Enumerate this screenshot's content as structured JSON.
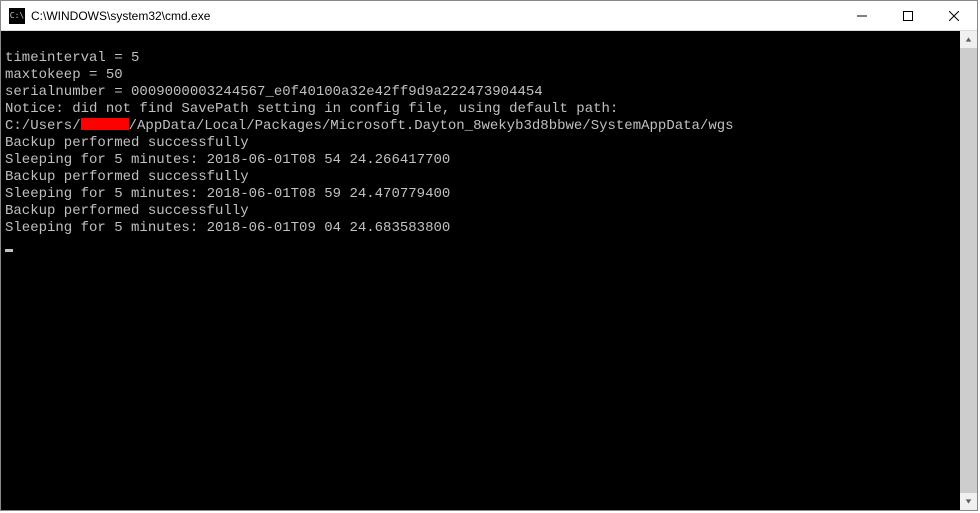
{
  "titlebar": {
    "title": "C:\\WINDOWS\\system32\\cmd.exe"
  },
  "terminal": {
    "lines": [
      "",
      "timeinterval = 5",
      "maxtokeep = 50",
      "serialnumber = 0009000003244567_e0f40100a32e42ff9d9a222473904454",
      "Notice: did not find SavePath setting in config file, using default path:",
      {
        "prefix": "C:/Users/",
        "redacted": true,
        "suffix": "/AppData/Local/Packages/Microsoft.Dayton_8wekyb3d8bbwe/SystemAppData/wgs"
      },
      "Backup performed successfully",
      "Sleeping for 5 minutes: 2018-06-01T08 54 24.266417700",
      "Backup performed successfully",
      "Sleeping for 5 minutes: 2018-06-01T08 59 24.470779400",
      "Backup performed successfully",
      "Sleeping for 5 minutes: 2018-06-01T09 04 24.683583800"
    ]
  }
}
